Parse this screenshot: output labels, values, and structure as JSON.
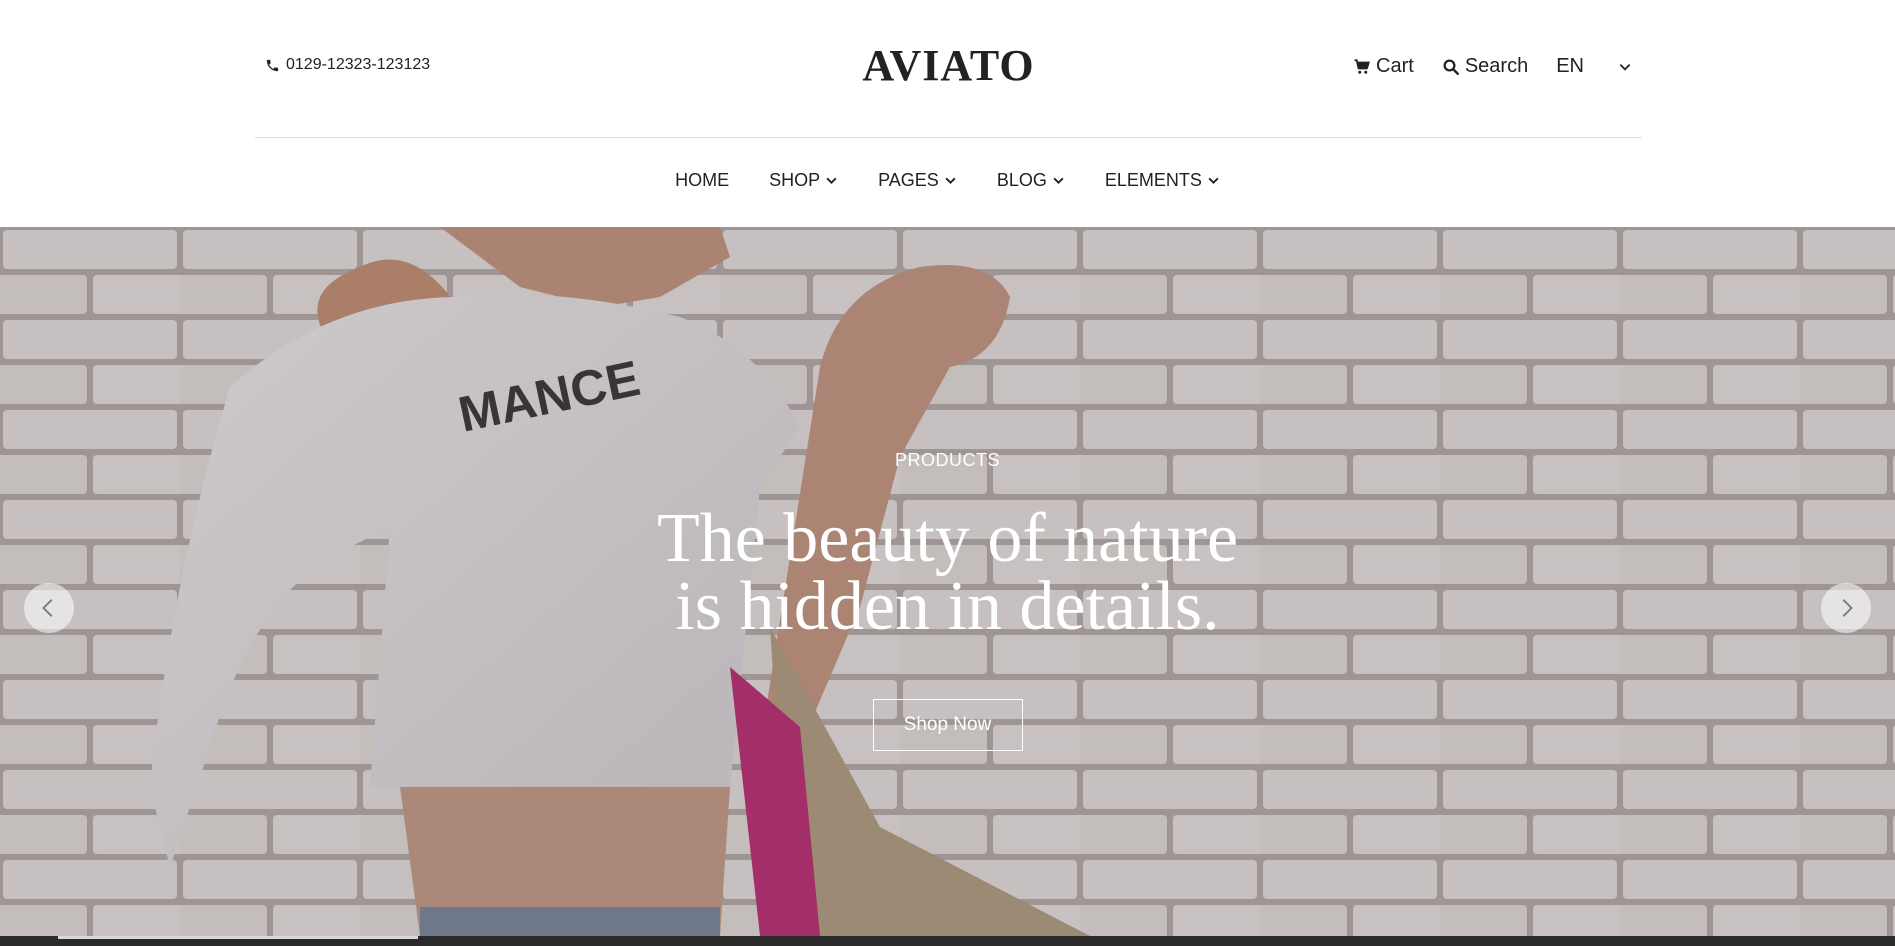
{
  "header": {
    "phone": "0129-12323-123123",
    "logo": "AVIATO",
    "cart_label": "Cart",
    "search_label": "Search",
    "language": "EN"
  },
  "nav": {
    "items": [
      {
        "label": "HOME"
      },
      {
        "label": "SHOP"
      },
      {
        "label": "PAGES"
      },
      {
        "label": "BLOG"
      },
      {
        "label": "ELEMENTS"
      }
    ]
  },
  "hero": {
    "kicker": "PRODUCTS",
    "headline_line1": "The beauty of nature",
    "headline_line2": "is hidden in details.",
    "cta_label": "Shop Now",
    "tshirt_text": "MANCE"
  },
  "icons": {
    "phone": "phone-icon",
    "cart": "cart-icon",
    "search": "search-icon",
    "chevron": "chevron-down-icon",
    "prev": "chevron-left-icon",
    "next": "chevron-right-icon"
  }
}
